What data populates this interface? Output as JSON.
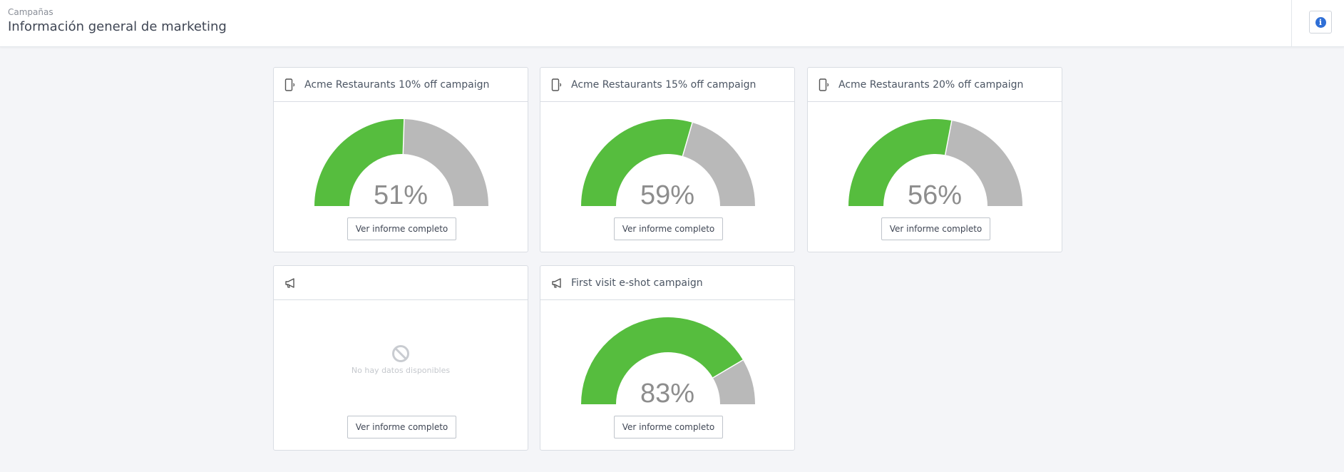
{
  "header": {
    "breadcrumb": "Campañas",
    "title": "Información general de marketing",
    "info_icon": "info-icon"
  },
  "colors": {
    "filled": "#56bd3e",
    "remaining": "#b9b9b9"
  },
  "cards": [
    {
      "icon": "mobile-signal-icon",
      "title": "Acme Restaurants 10% off campaign",
      "percent": 51,
      "percent_label": "51%",
      "button": "Ver informe completo"
    },
    {
      "icon": "mobile-signal-icon",
      "title": "Acme Restaurants 15% off campaign",
      "percent": 59,
      "percent_label": "59%",
      "button": "Ver informe completo"
    },
    {
      "icon": "mobile-signal-icon",
      "title": "Acme Restaurants 20% off campaign",
      "percent": 56,
      "percent_label": "56%",
      "button": "Ver informe completo"
    },
    {
      "icon": "megaphone-icon",
      "title": "",
      "no_data": "No hay datos disponibles",
      "button": "Ver informe completo"
    },
    {
      "icon": "megaphone-icon",
      "title": "First visit e-shot campaign",
      "percent": 83,
      "percent_label": "83%",
      "button": "Ver informe completo"
    }
  ]
}
